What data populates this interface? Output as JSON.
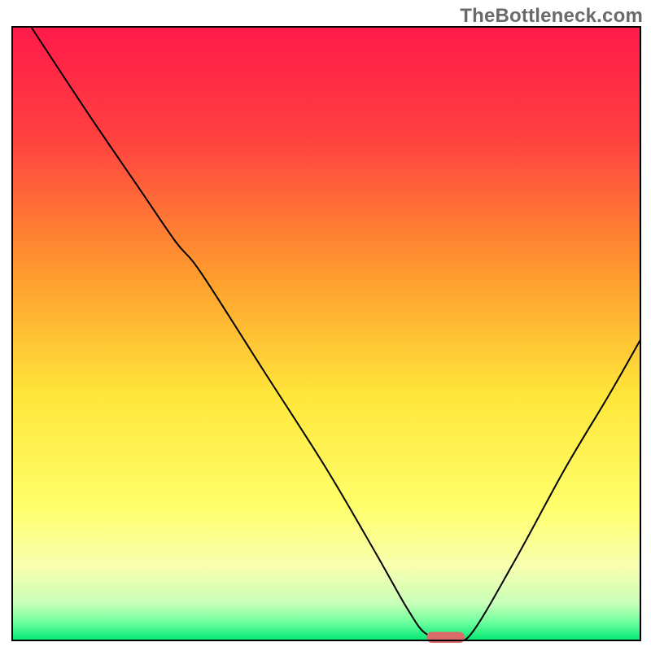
{
  "watermark": "TheBottleneck.com",
  "chart_data": {
    "type": "line",
    "title": "",
    "xlabel": "",
    "ylabel": "",
    "xlim": [
      0,
      100
    ],
    "ylim": [
      0,
      100
    ],
    "grid": false,
    "legend": false,
    "background_gradient_stops": [
      {
        "offset": 0.0,
        "color": "#ff1a4a"
      },
      {
        "offset": 0.18,
        "color": "#ff4040"
      },
      {
        "offset": 0.4,
        "color": "#ff9a2e"
      },
      {
        "offset": 0.6,
        "color": "#ffe63a"
      },
      {
        "offset": 0.78,
        "color": "#ffff6a"
      },
      {
        "offset": 0.88,
        "color": "#f8ffb0"
      },
      {
        "offset": 0.94,
        "color": "#c8ffb8"
      },
      {
        "offset": 0.97,
        "color": "#6eff9e"
      },
      {
        "offset": 1.0,
        "color": "#00e873"
      }
    ],
    "series": [
      {
        "name": "bottleneck-curve",
        "stroke": "#000000",
        "stroke_width": 2,
        "points": [
          {
            "x": 3,
            "y": 100
          },
          {
            "x": 12,
            "y": 86
          },
          {
            "x": 20,
            "y": 74
          },
          {
            "x": 26,
            "y": 65
          },
          {
            "x": 30,
            "y": 60
          },
          {
            "x": 40,
            "y": 44
          },
          {
            "x": 50,
            "y": 28
          },
          {
            "x": 58,
            "y": 14
          },
          {
            "x": 63,
            "y": 5
          },
          {
            "x": 66,
            "y": 1
          },
          {
            "x": 70,
            "y": 0.5
          },
          {
            "x": 73,
            "y": 1
          },
          {
            "x": 80,
            "y": 13
          },
          {
            "x": 88,
            "y": 28
          },
          {
            "x": 95,
            "y": 40
          },
          {
            "x": 100,
            "y": 49
          }
        ]
      }
    ],
    "marker": {
      "name": "optimal-marker",
      "x": 69,
      "y": 0.5,
      "width": 6,
      "height": 1.8,
      "fill": "#d96b6b"
    },
    "frame_stroke": "#000000",
    "frame_stroke_width": 2
  }
}
